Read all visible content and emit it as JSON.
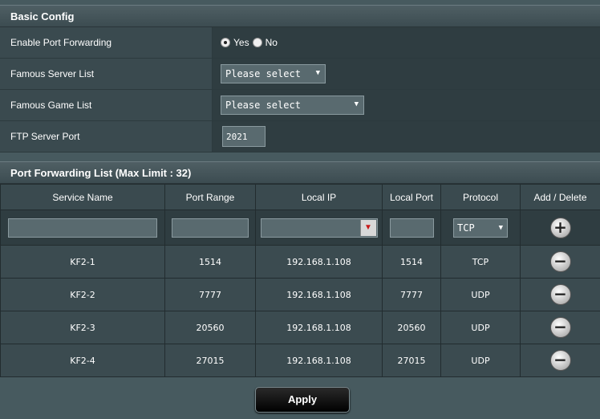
{
  "basic_config": {
    "title": "Basic Config",
    "rows": [
      {
        "label": "Enable Port Forwarding"
      },
      {
        "label": "Famous Server List",
        "value": "Please select"
      },
      {
        "label": "Famous Game List",
        "value": "Please select"
      },
      {
        "label": "FTP Server Port",
        "value": "2021"
      }
    ],
    "enable_yes": "Yes",
    "enable_no": "No",
    "enable_selected": "Yes"
  },
  "pf_list": {
    "title": "Port Forwarding List (Max Limit : 32)",
    "headers": [
      "Service Name",
      "Port Range",
      "Local IP",
      "Local Port",
      "Protocol",
      "Add / Delete"
    ],
    "input_protocol": "TCP",
    "rows": [
      {
        "service": "KF2-1",
        "port_range": "1514",
        "local_ip": "192.168.1.108",
        "local_port": "1514",
        "protocol": "TCP"
      },
      {
        "service": "KF2-2",
        "port_range": "7777",
        "local_ip": "192.168.1.108",
        "local_port": "7777",
        "protocol": "UDP"
      },
      {
        "service": "KF2-3",
        "port_range": "20560",
        "local_ip": "192.168.1.108",
        "local_port": "20560",
        "protocol": "UDP"
      },
      {
        "service": "KF2-4",
        "port_range": "27015",
        "local_ip": "192.168.1.108",
        "local_port": "27015",
        "protocol": "UDP"
      }
    ]
  },
  "apply_label": "Apply",
  "icons": {
    "add": "plus-circle-icon",
    "delete": "minus-circle-icon",
    "dropdown": "chevron-down-icon"
  },
  "colors": {
    "background": "#475a5f",
    "label_cell": "#3a4a4f",
    "value_cell": "#2f3d41",
    "apply_button": "#000000"
  }
}
